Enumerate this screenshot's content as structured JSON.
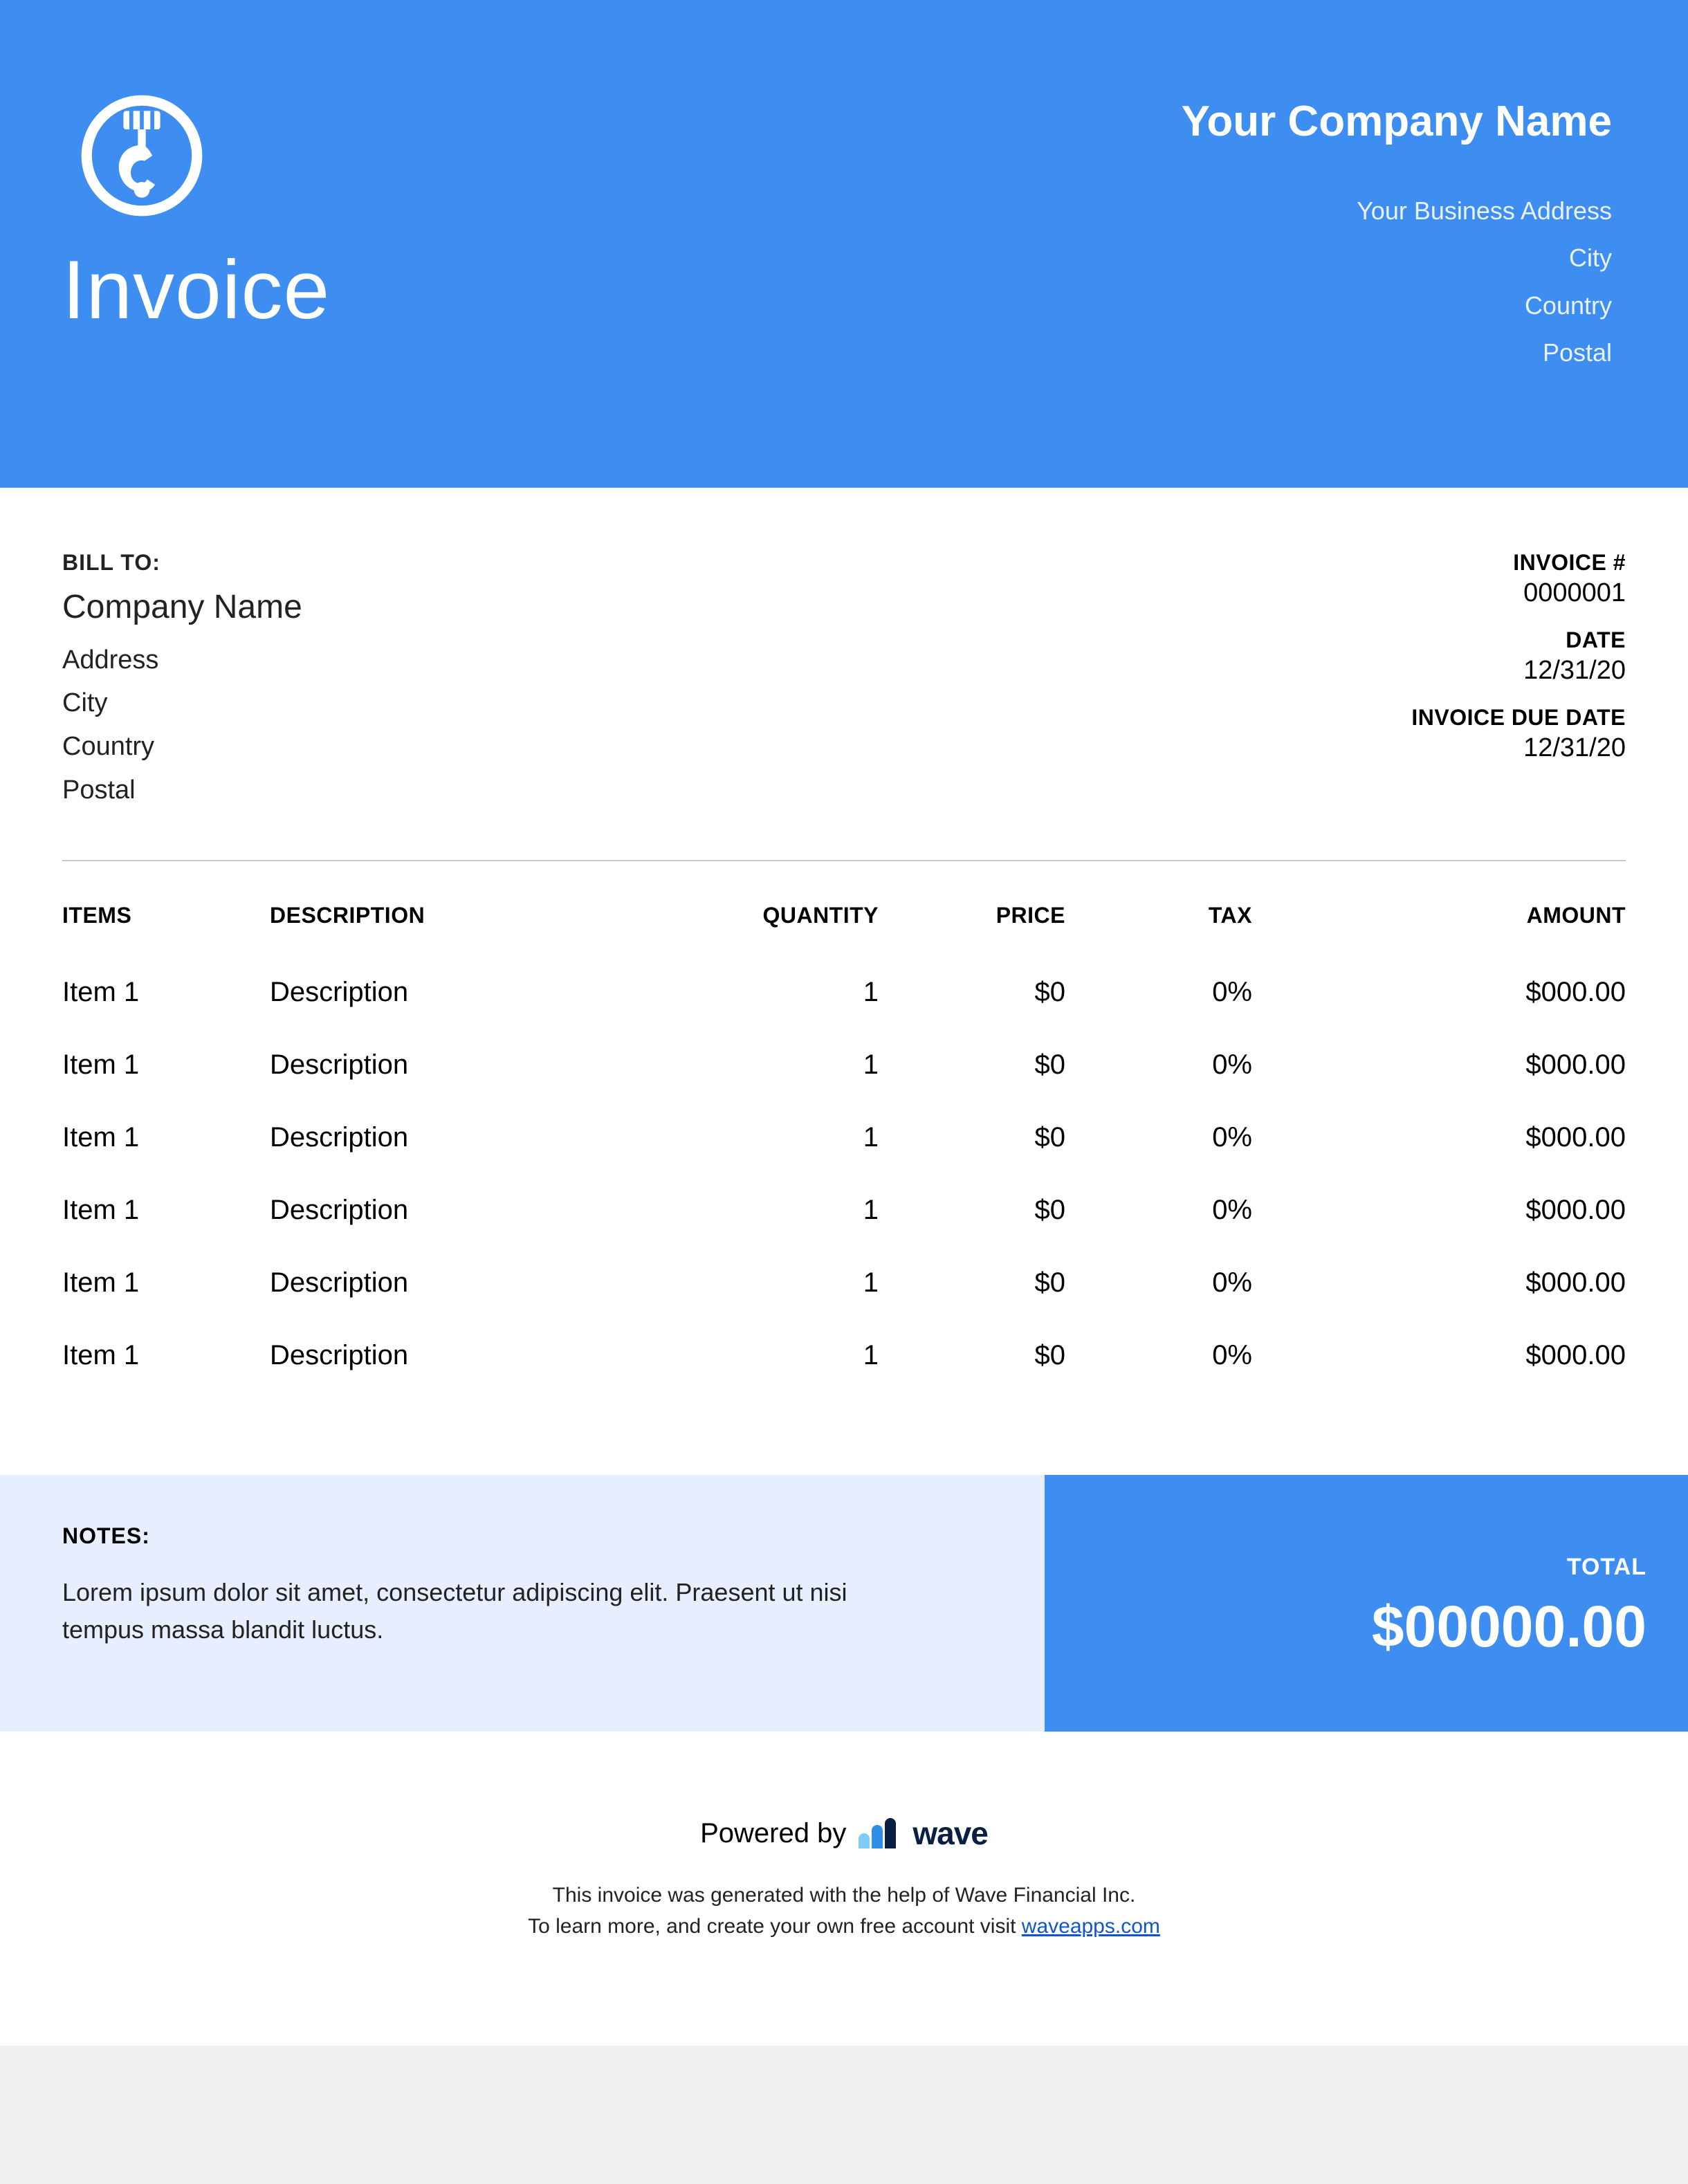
{
  "colors": {
    "brand": "#3e8df0",
    "notes_bg": "#e7efff"
  },
  "header": {
    "doc_title": "Invoice",
    "company_name": "Your Company Name",
    "address": "Your Business Address",
    "city": "City",
    "country": "Country",
    "postal": "Postal",
    "logo_icon": "hook-icon"
  },
  "bill_to": {
    "label": "BILL TO:",
    "company": "Company Name",
    "address": "Address",
    "city": "City",
    "country": "Country",
    "postal": "Postal"
  },
  "meta": {
    "invoice_label": "INVOICE #",
    "invoice_number": "0000001",
    "date_label": "DATE",
    "date": "12/31/20",
    "due_label": "INVOICE DUE DATE",
    "due_date": "12/31/20"
  },
  "columns": {
    "items": "ITEMS",
    "description": "DESCRIPTION",
    "quantity": "QUANTITY",
    "price": "PRICE",
    "tax": "TAX",
    "amount": "AMOUNT"
  },
  "line_items": [
    {
      "item": "Item 1",
      "description": "Description",
      "quantity": "1",
      "price": "$0",
      "tax": "0%",
      "amount": "$000.00"
    },
    {
      "item": "Item 1",
      "description": "Description",
      "quantity": "1",
      "price": "$0",
      "tax": "0%",
      "amount": "$000.00"
    },
    {
      "item": "Item 1",
      "description": "Description",
      "quantity": "1",
      "price": "$0",
      "tax": "0%",
      "amount": "$000.00"
    },
    {
      "item": "Item 1",
      "description": "Description",
      "quantity": "1",
      "price": "$0",
      "tax": "0%",
      "amount": "$000.00"
    },
    {
      "item": "Item 1",
      "description": "Description",
      "quantity": "1",
      "price": "$0",
      "tax": "0%",
      "amount": "$000.00"
    },
    {
      "item": "Item 1",
      "description": "Description",
      "quantity": "1",
      "price": "$0",
      "tax": "0%",
      "amount": "$000.00"
    }
  ],
  "notes": {
    "label": "NOTES:",
    "text": "Lorem ipsum dolor sit amet, consectetur adipiscing elit. Praesent ut nisi tempus massa blandit luctus."
  },
  "total": {
    "label": "TOTAL",
    "value": "$00000.00"
  },
  "footer": {
    "powered_by": "Powered by",
    "brand": "wave",
    "line1": "This invoice was generated with the help of Wave Financial Inc.",
    "line2_pre": "To learn more, and create your own free account visit ",
    "link_text": "waveapps.com"
  }
}
